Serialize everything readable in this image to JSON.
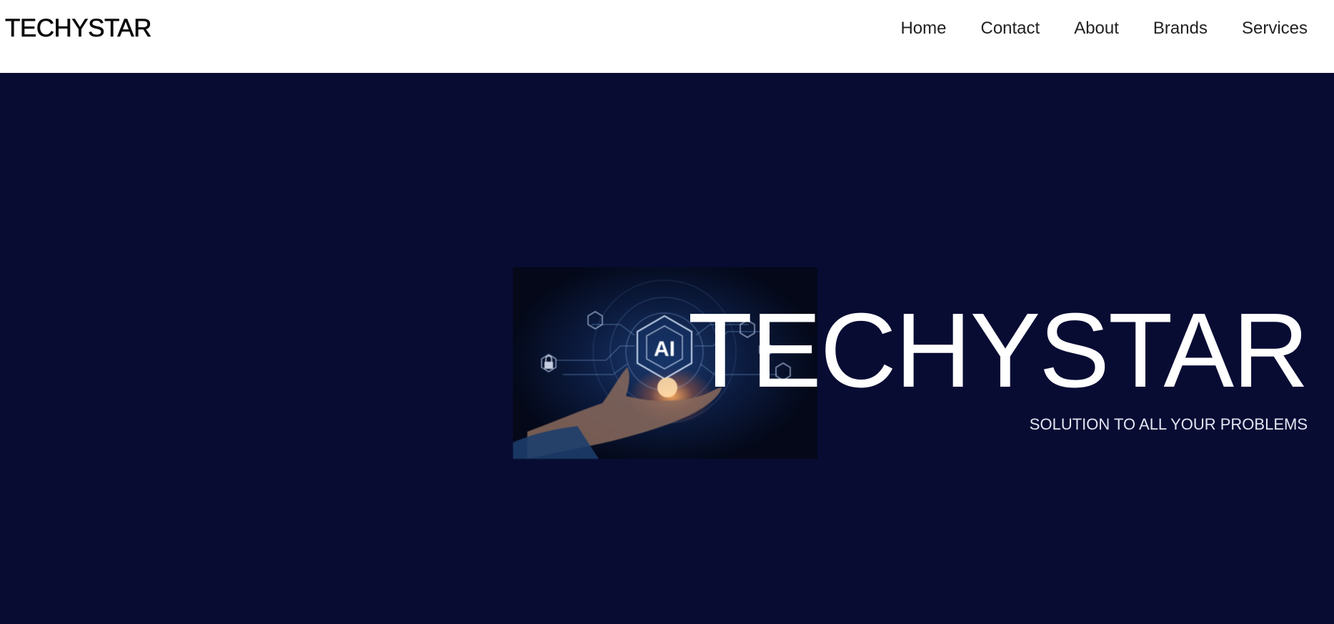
{
  "navbar": {
    "brand": "TECHYSTAR",
    "links": [
      {
        "label": "Home"
      },
      {
        "label": "Contact"
      },
      {
        "label": "About"
      },
      {
        "label": "Brands"
      },
      {
        "label": "Services"
      }
    ]
  },
  "hero": {
    "title": "TECHYSTAR",
    "subtitle": "SOLUTION TO ALL YOUR PROBLEMS",
    "image_badge": "AI",
    "background_color": "#080c33"
  }
}
